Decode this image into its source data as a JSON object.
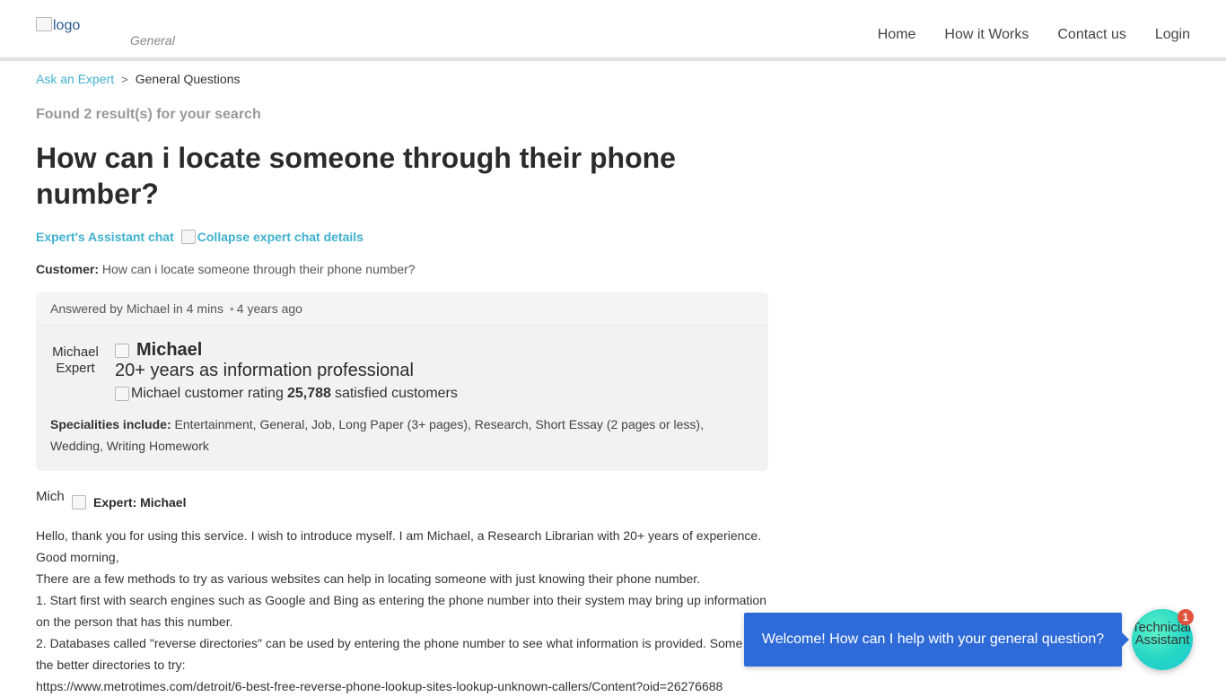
{
  "header": {
    "logo_alt": "logo",
    "category": "General",
    "nav": [
      "Home",
      "How it Works",
      "Contact us",
      "Login"
    ]
  },
  "breadcrumb": {
    "link": "Ask an Expert",
    "separator": ">",
    "current": "General Questions"
  },
  "results_text": "Found 2 result(s) for your search",
  "question_title": "How can i locate someone through their phone number?",
  "chat_toggle": {
    "label": "Expert's Assistant chat",
    "collapse_alt": "Collapse expert chat details"
  },
  "customer": {
    "label": "Customer:",
    "text": "How can i locate someone through their phone number?"
  },
  "answer_card": {
    "answered_by": "Answered by Michael in 4 mins",
    "answered_ago": "4 years ago",
    "avatar_alt": "Michael Expert",
    "expert_name": "Michael",
    "expert_title": "20+ years as information professional",
    "rating_alt": "Michael customer rating",
    "satisfied_count": "25,788",
    "satisfied_label": "satisfied customers",
    "specialities_label": "Specialities include:",
    "specialities": "Entertainment, General, Job, Long Paper (3+ pages), Research, Short Essay (2 pages or less), Wedding, Writing Homework"
  },
  "message": {
    "avatar_alt": "Michael",
    "header": "Expert: Michael",
    "lines": [
      "Hello, thank you for using this service. I wish to introduce myself. I am Michael, a Research Librarian with 20+ years of experience.",
      "Good morning,",
      "There are a few methods to try as various websites can help in locating someone with just knowing their phone number.",
      "1. Start first with search engines such as Google and Bing as entering the phone number into their system may bring up information on the person that has this number.",
      "2. Databases called \"reverse directories\" can be used by entering the phone number to see what information is provided. Some of the better directories to try:",
      "https://www.metrotimes.com/detroit/6-best-free-reverse-phone-lookup-sites-lookup-unknown-callers/Content?oid=26276688"
    ]
  },
  "chat_widget": {
    "bubble_text": "Welcome! How can I help with your general question?",
    "assistant_alt": "Technician Assistant",
    "badge_count": "1"
  },
  "colors": {
    "link": "#3fb1d0",
    "bubble": "#2e6bd9",
    "assistant": "#25d6c4",
    "badge": "#e2533d"
  }
}
